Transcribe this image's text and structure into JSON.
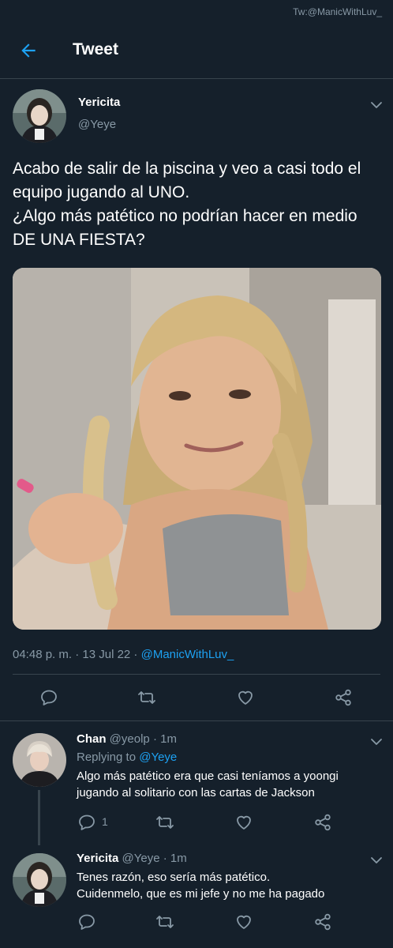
{
  "watermark": "Tw:@ManicWithLuv_",
  "header": {
    "title": "Tweet",
    "back_icon": "arrow-left-icon"
  },
  "main_tweet": {
    "author_name": "Yericita",
    "author_handle": "@Yeye",
    "text": "Acabo de salir de la piscina y veo a casi todo el equipo jugando al UNO.\n¿Algo más patético no podrían hacer en medio DE UNA FIESTA?",
    "time": "04:48 p. m. · 13 Jul 22 · ",
    "via": "@ManicWithLuv_"
  },
  "replies": [
    {
      "name": "Chan",
      "handle": "@yeolp",
      "age": "· 1m",
      "replying_prefix": "Replying to ",
      "replying_to": "@Yeye",
      "text": "Algo más patético era que casi teníamos a yoongi\njugando al solitario con las cartas de Jackson",
      "reply_count": "1"
    },
    {
      "name": "Yericita",
      "handle": "@Yeye",
      "age": "· 1m",
      "text": "Tenes razón, eso sería más patético.\nCuidenmelo, que es mi jefe y no me ha pagado"
    }
  ],
  "colors": {
    "background": "#15202b",
    "accent": "#1da1f2",
    "muted": "#8899a6",
    "border": "#38444d"
  }
}
